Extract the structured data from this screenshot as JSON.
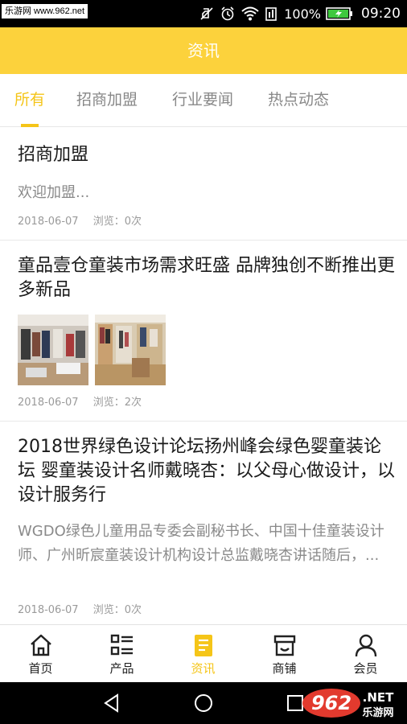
{
  "status_bar": {
    "watermark": "乐游网 www.962.net",
    "battery": "100%",
    "time": "09:20"
  },
  "header": {
    "title": "资讯"
  },
  "tabs": [
    {
      "label": "所有",
      "active": true
    },
    {
      "label": "招商加盟",
      "active": false
    },
    {
      "label": "行业要闻",
      "active": false
    },
    {
      "label": "热点动态",
      "active": false
    }
  ],
  "articles": [
    {
      "title": "招商加盟",
      "summary": "欢迎加盟...",
      "date": "2018-06-07",
      "views": "浏览：0次"
    },
    {
      "title": "童品壹仓童装市场需求旺盛 品牌独创不断推出更多新品",
      "date": "2018-06-07",
      "views": "浏览：2次"
    },
    {
      "title": "2018世界绿色设计论坛扬州峰会绿色婴童装论坛 婴童装设计名师戴晓杏：以父母心做设计，以设计服务行",
      "summary": "WGDO绿色儿童用品专委会副秘书长、中国十佳童装设计师、广州昕宸童装设计机构设计总监戴晓杏讲话随后，...",
      "date": "2018-06-07",
      "views": "浏览：0次"
    }
  ],
  "bottom_nav": [
    {
      "label": "首页",
      "icon": "home-icon",
      "active": false
    },
    {
      "label": "产品",
      "icon": "list-icon",
      "active": false
    },
    {
      "label": "资讯",
      "icon": "news-icon",
      "active": true
    },
    {
      "label": "商铺",
      "icon": "store-icon",
      "active": false
    },
    {
      "label": "会员",
      "icon": "user-icon",
      "active": false
    }
  ],
  "watermark_logo": {
    "number": "962",
    "suffix": ".NET",
    "text": "乐游网"
  },
  "colors": {
    "accent": "#fcd23c",
    "active_text": "#f5c518"
  }
}
